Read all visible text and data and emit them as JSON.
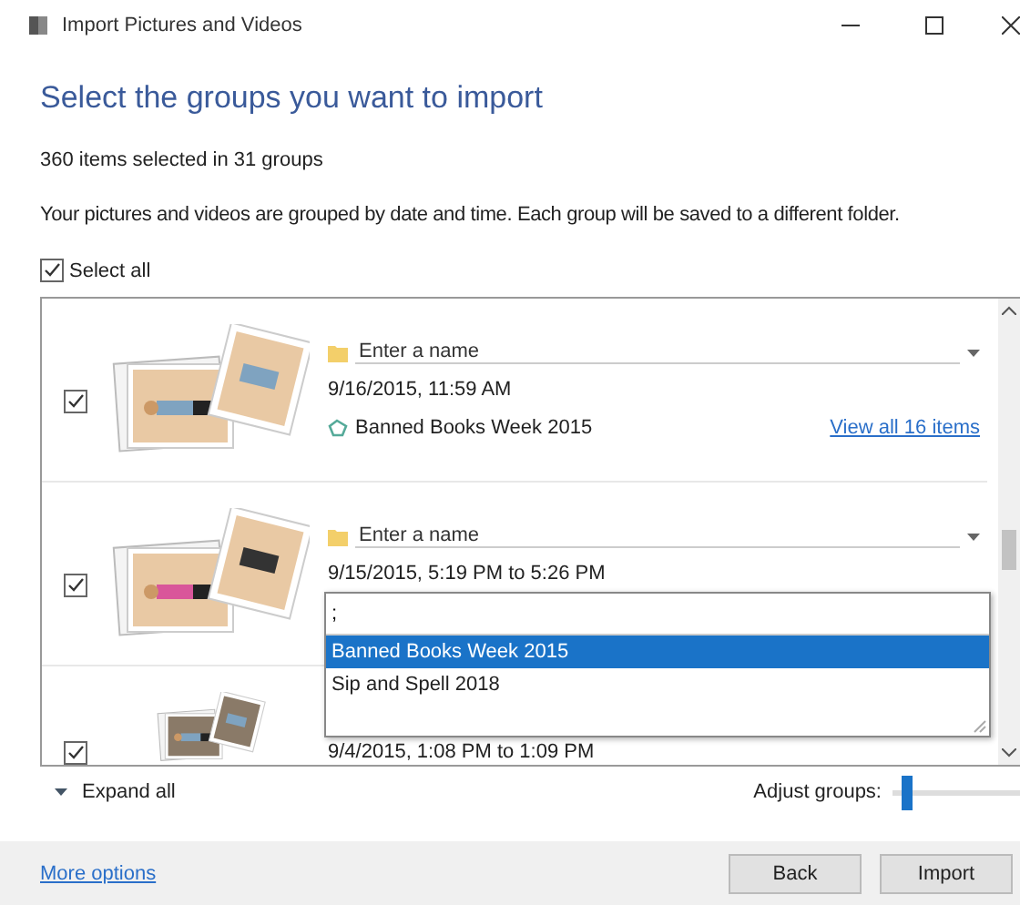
{
  "window": {
    "title": "Import Pictures and Videos"
  },
  "heading": "Select the groups you want to import",
  "summary": "360 items selected in 31 groups",
  "description": "Your pictures and videos are grouped by date and time. Each group will be saved to a different folder.",
  "select_all": {
    "label": "Select all",
    "checked": true
  },
  "groups": [
    {
      "checked": true,
      "name_placeholder": "Enter a name",
      "date": "9/16/2015, 11:59 AM",
      "tag": "Banned Books Week 2015",
      "link": "View all 16 items"
    },
    {
      "checked": true,
      "name_placeholder": "Enter a name",
      "date": "9/15/2015, 5:19 PM to 5:26 PM"
    },
    {
      "checked": true,
      "date": "9/4/2015, 1:08 PM to 1:09 PM"
    }
  ],
  "tag_dropdown": {
    "value": ";",
    "options": [
      {
        "label": "Banned Books Week 2015",
        "selected": true
      },
      {
        "label": "Sip and Spell 2018",
        "selected": false
      }
    ]
  },
  "expand_all": "Expand all",
  "adjust_groups": {
    "label": "Adjust groups:",
    "level": 0.12
  },
  "more_options": "More options",
  "buttons": [
    "Back",
    "Import"
  ]
}
